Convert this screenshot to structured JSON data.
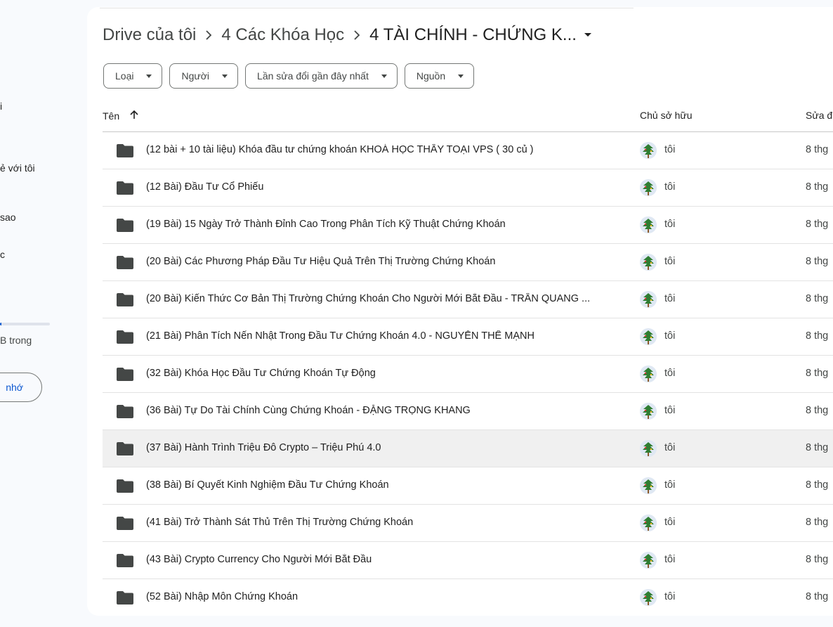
{
  "sidebar": {
    "items": [
      {
        "label": "i"
      },
      {
        "label": "ẻ với tôi"
      },
      {
        "label": "sao"
      },
      {
        "label": "c"
      }
    ],
    "storage_text": "B trong",
    "storage_used_fraction": 0.03,
    "storage_button": "nhớ"
  },
  "breadcrumb": {
    "items": [
      "Drive của tôi",
      "4 Các Khóa Học"
    ],
    "current": "4 TÀI CHÍNH - CHỨNG K..."
  },
  "filters": [
    "Loại",
    "Người",
    "Lần sửa đổi gần đây nhất",
    "Nguồn"
  ],
  "columns": {
    "name": "Tên",
    "owner": "Chủ sở hữu",
    "modified": "Sửa đ"
  },
  "rows": [
    {
      "name": "(12 bài + 10 tài liệu) Khóa đầu tư chứng khoán KHOÁ HỌC THẦY TOẠI VPS ( 30 củ )",
      "owner": "tôi",
      "modified": "8 thg"
    },
    {
      "name": "(12 Bài) Đầu Tư Cổ Phiếu",
      "owner": "tôi",
      "modified": "8 thg"
    },
    {
      "name": "(19 Bài) 15 Ngày Trở Thành Đỉnh Cao Trong Phân Tích Kỹ Thuật Chứng Khoán",
      "owner": "tôi",
      "modified": "8 thg"
    },
    {
      "name": "(20 Bài) Các Phương Pháp Đầu Tư Hiệu Quả Trên Thị Trường Chứng Khoán",
      "owner": "tôi",
      "modified": "8 thg"
    },
    {
      "name": "(20 Bài) Kiến Thức Cơ Bản Thị Trường Chứng Khoán Cho Người Mới Bắt Đầu - TRẦN QUANG ...",
      "owner": "tôi",
      "modified": "8 thg"
    },
    {
      "name": "(21 Bài) Phân Tích Nến Nhật Trong Đầu Tư Chứng Khoán 4.0 - NGUYỄN THẾ MẠNH",
      "owner": "tôi",
      "modified": "8 thg"
    },
    {
      "name": "(32 Bài) Khóa Học Đầu Tư Chứng Khoán Tự Động",
      "owner": "tôi",
      "modified": "8 thg"
    },
    {
      "name": "(36 Bài) Tự Do Tài Chính Cùng Chứng Khoán - ĐẶNG TRỌNG KHANG",
      "owner": "tôi",
      "modified": "8 thg"
    },
    {
      "name": "(37 Bài) Hành Trình Triệu Đô Crypto – Triệu Phú 4.0",
      "owner": "tôi",
      "modified": "8 thg",
      "hover": true
    },
    {
      "name": "(38 Bài) Bí Quyết Kinh Nghiệm Đầu Tư Chứng Khoán",
      "owner": "tôi",
      "modified": "8 thg"
    },
    {
      "name": "(41 Bài) Trở Thành Sát Thủ Trên Thị Trường Chứng Khoán",
      "owner": "tôi",
      "modified": "8 thg"
    },
    {
      "name": "(43 Bài) Crypto Currency Cho Người Mới Bắt Đầu",
      "owner": "tôi",
      "modified": "8 thg"
    },
    {
      "name": "(52 Bài) Nhập Môn Chứng Khoán",
      "owner": "tôi",
      "modified": "8 thg"
    }
  ],
  "icons": {
    "folder": "folder-icon",
    "sort": "arrow-up-icon",
    "separator": "chevron-right-icon",
    "dropdown": "caret-down-icon",
    "avatar": "user-avatar"
  },
  "colors": {
    "accent": "#0b57d0",
    "folder": "#444746",
    "hover_row": "#f0f0f0"
  }
}
